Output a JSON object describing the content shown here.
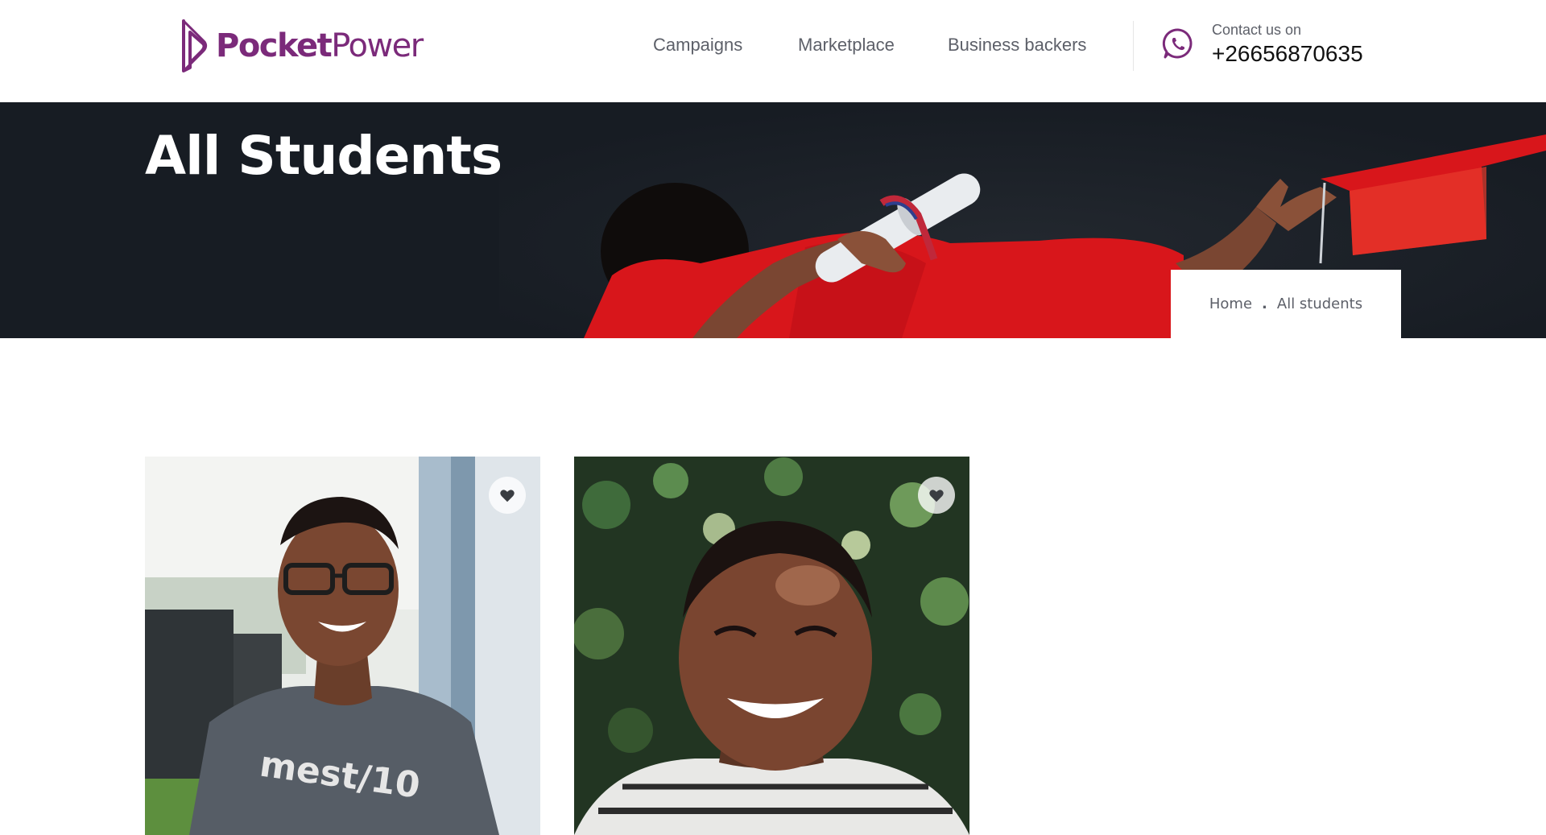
{
  "brand": {
    "name_bold": "Pocket",
    "name_light": "Power",
    "color": "#7b2a7a"
  },
  "nav": {
    "items": [
      {
        "label": "Campaigns"
      },
      {
        "label": "Marketplace"
      },
      {
        "label": "Business backers"
      }
    ]
  },
  "contact": {
    "label": "Contact us on",
    "phone": "+26656870635",
    "icon": "whatsapp-icon"
  },
  "hero": {
    "title": "All Students",
    "background_color": "#171c23"
  },
  "breadcrumb": {
    "items": [
      {
        "label": "Home"
      },
      {
        "label": "All students"
      }
    ],
    "separator": "."
  },
  "students": [
    {
      "favorite_icon": "heart-icon"
    },
    {
      "favorite_icon": "heart-icon"
    }
  ],
  "colors": {
    "accent": "#7b2a7a",
    "nav_text": "#5d6069",
    "gown_red": "#e0191c"
  }
}
